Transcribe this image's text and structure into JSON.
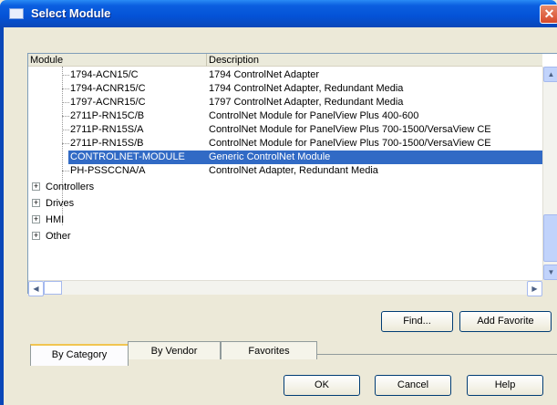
{
  "window": {
    "title": "Select Module",
    "close_glyph": "✕"
  },
  "table": {
    "columns": [
      "Module",
      "Description"
    ],
    "rows": [
      {
        "module": "1794-ACN15/C",
        "description": "1794 ControlNet Adapter"
      },
      {
        "module": "1794-ACNR15/C",
        "description": "1794 ControlNet Adapter, Redundant Media"
      },
      {
        "module": "1797-ACNR15/C",
        "description": "1797 ControlNet Adapter, Redundant Media"
      },
      {
        "module": "2711P-RN15C/B",
        "description": "ControlNet Module for PanelView Plus 400-600"
      },
      {
        "module": "2711P-RN15S/A",
        "description": "ControlNet Module for PanelView Plus 700-1500/VersaView CE"
      },
      {
        "module": "2711P-RN15S/B",
        "description": "ControlNet Module for PanelView Plus 700-1500/VersaView CE"
      },
      {
        "module": "CONTROLNET-MODULE",
        "description": "Generic ControlNet Module",
        "selected": true
      },
      {
        "module": "PH-PSSCCNA/A",
        "description": "ControlNet Adapter, Redundant Media"
      }
    ],
    "categories": [
      {
        "label": "Controllers",
        "expander": "+"
      },
      {
        "label": "Drives",
        "expander": "+"
      },
      {
        "label": "HMI",
        "expander": "+"
      },
      {
        "label": "Other",
        "expander": "+"
      }
    ]
  },
  "scroll": {
    "up": "▲",
    "down": "▼",
    "left": "◀",
    "right": "▶"
  },
  "buttons": {
    "find": "Find...",
    "add_favorite": "Add Favorite",
    "ok": "OK",
    "cancel": "Cancel",
    "help": "Help"
  },
  "tabs": {
    "by_category": "By Category",
    "by_vendor": "By Vendor",
    "favorites": "Favorites"
  }
}
